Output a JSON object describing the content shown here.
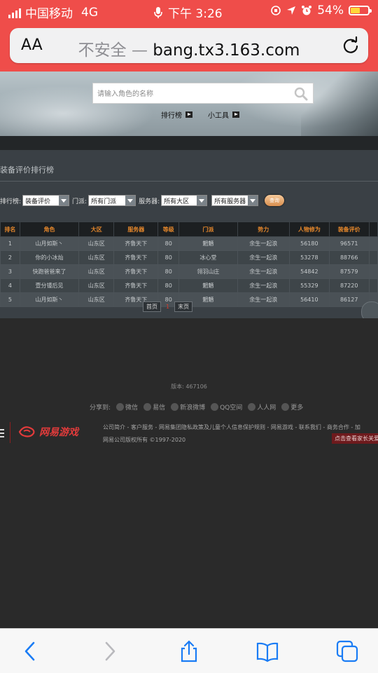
{
  "status": {
    "carrier": "中国移动",
    "network": "4G",
    "time": "下午 3:26",
    "battery": "54%",
    "battery_level": 0.54
  },
  "browser": {
    "aa_label": "AA",
    "insecure_label": "不安全 —",
    "domain": "bang.tx3.163.com"
  },
  "hero": {
    "search_placeholder": "请输入角色的名称",
    "nav": [
      {
        "label": "排行榜"
      },
      {
        "label": "小工具"
      }
    ]
  },
  "panel": {
    "title": "装备评价排行榜",
    "filters": {
      "rank_label": "排行榜:",
      "rank_value": "装备评价",
      "school_label": "门派:",
      "school_value": "所有门派",
      "server_label": "服务器:",
      "region_value": "所有大区",
      "server_value": "所有服务器",
      "query_label": "查询"
    },
    "table": {
      "headers": [
        "排名",
        "角色",
        "大区",
        "服务器",
        "等级",
        "门派",
        "势力",
        "人物修为",
        "装备评价"
      ],
      "rows": [
        [
          "1",
          "山月如斯丶",
          "山东区",
          "齐鲁天下",
          "80",
          "魍魉",
          "余生一起浪",
          "56180",
          "96571"
        ],
        [
          "2",
          "你的小冰灿",
          "山东区",
          "齐鲁天下",
          "80",
          "冰心堂",
          "余生一起浪",
          "53278",
          "88766"
        ],
        [
          "3",
          "快跑爸爸来了",
          "山东区",
          "齐鲁天下",
          "80",
          "翎羽山庄",
          "余生一起浪",
          "54842",
          "87579"
        ],
        [
          "4",
          "壹分锺后见",
          "山东区",
          "齐鲁天下",
          "80",
          "魍魉",
          "余生一起浪",
          "55329",
          "87220"
        ],
        [
          "5",
          "山月如斯丶",
          "山东区",
          "齐鲁天下",
          "80",
          "魍魉",
          "余生一起浪",
          "56410",
          "86127"
        ]
      ]
    },
    "pager": {
      "first": "首页",
      "current": "1",
      "last": "末页"
    }
  },
  "footer": {
    "version": "版本: 467106",
    "share_label": "分享到:",
    "share_items": [
      {
        "label": "微信",
        "icon": "wechat-icon"
      },
      {
        "label": "易信",
        "icon": "yixin-icon"
      },
      {
        "label": "新浪微博",
        "icon": "weibo-icon"
      },
      {
        "label": "QQ空间",
        "icon": "qzone-icon"
      },
      {
        "label": "人人网",
        "icon": "renren-icon"
      },
      {
        "label": "更多",
        "icon": "more-icon"
      }
    ],
    "logo_text": "网易游戏",
    "links": "公司简介 - 客户服务 - 网易集团隐私政策及儿童个人信息保护规则 - 网易游戏 - 联系我们 - 商务合作 - 加",
    "copyright": "网易公司版权所有 ©1997-2020",
    "parent_notice": "点击查看家长关爱"
  },
  "colors": {
    "status_red": "#ef4d4a",
    "table_header_text": "#e3862b",
    "logo_red": "#e23b3b",
    "ios_blue": "#1a7cf5"
  }
}
